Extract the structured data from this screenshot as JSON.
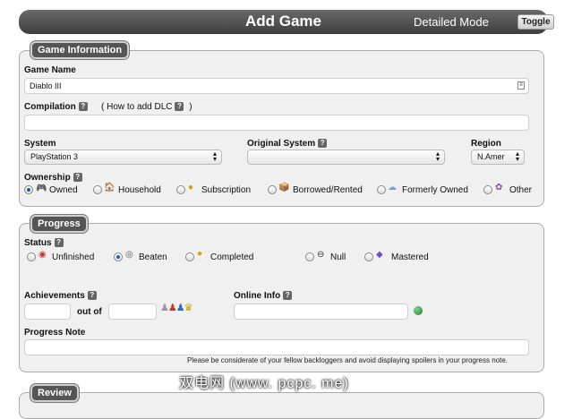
{
  "header": {
    "title": "Add Game",
    "mode_label": "Detailed Mode",
    "toggle_label": "Toggle"
  },
  "game_info": {
    "legend": "Game Information",
    "game_name_label": "Game Name",
    "game_name_value": "Diablo III",
    "compilation_label": "Compilation",
    "dlc_text": "( How to add DLC",
    "dlc_close": ")",
    "system_label": "System",
    "system_value": "PlayStation 3",
    "original_system_label": "Original System",
    "original_system_value": "",
    "region_label": "Region",
    "region_value": "N.Amer",
    "ownership_label": "Ownership",
    "ownership_options": [
      "Owned",
      "Household",
      "Subscription",
      "Borrowed/Rented",
      "Formerly Owned",
      "Other"
    ],
    "ownership_selected": "Owned"
  },
  "progress": {
    "legend": "Progress",
    "status_label": "Status",
    "status_options": [
      "Unfinished",
      "Beaten",
      "Completed",
      "Null",
      "Mastered"
    ],
    "status_selected": "Beaten",
    "achievements_label": "Achievements",
    "out_of_text": "out of",
    "online_info_label": "Online Info",
    "progress_note_label": "Progress Note",
    "progress_note_hint": "Please be considerate of your fellow backloggers and avoid displaying spoilers in your progress note."
  },
  "review": {
    "legend": "Review"
  },
  "help_icon_text": "?",
  "watermark": "双电网 (www. pcpc. me)",
  "colors": {
    "header_bg": "#4a4a4a",
    "section_bg": "#f0f0f0",
    "radio_selected": "#1c5fb8"
  }
}
